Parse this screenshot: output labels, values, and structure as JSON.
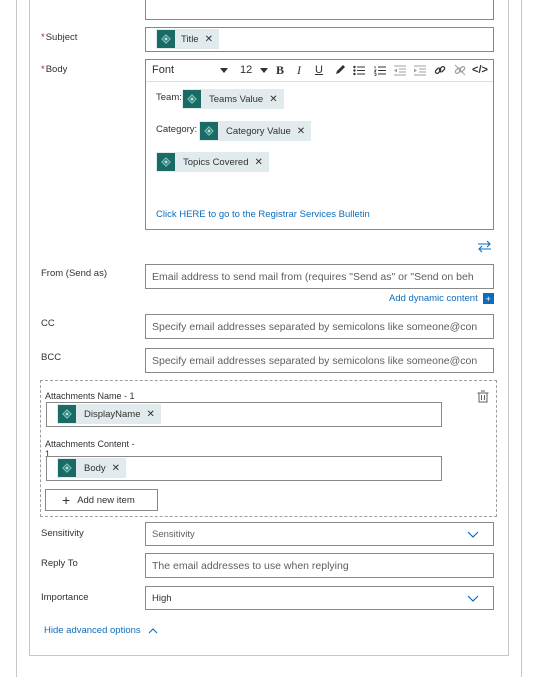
{
  "subject": {
    "label": "Subject",
    "required_mark": "*",
    "token": "Title"
  },
  "body": {
    "label": "Body",
    "required_mark": "*",
    "toolbar": {
      "font_label": "Font",
      "size_label": "12",
      "bold": "B",
      "italic": "I",
      "underline": "U",
      "code": "</>"
    },
    "team_prefix": "Team:",
    "team_token": "Teams Value",
    "category_prefix": "Category:",
    "category_token": "Category Value",
    "topics_token": "Topics Covered",
    "bulletin_link": "Click HERE to go to the Registrar Services Bulletin"
  },
  "from": {
    "label": "From (Send as)",
    "placeholder": "Email address to send mail from (requires \"Send as\" or \"Send on beh"
  },
  "add_dynamic": {
    "label": "Add dynamic content",
    "plus": "+"
  },
  "cc": {
    "label": "CC",
    "placeholder": "Specify email addresses separated by semicolons like someone@con"
  },
  "bcc": {
    "label": "BCC",
    "placeholder": "Specify email addresses separated by semicolons like someone@con"
  },
  "attachments": {
    "name_label": "Attachments Name - 1",
    "name_token": "DisplayName",
    "content_label": "Attachments Content -",
    "content_label_2": "1",
    "content_token": "Body",
    "add_item": "Add new item"
  },
  "sensitivity": {
    "label": "Sensitivity",
    "value": "Sensitivity"
  },
  "reply_to": {
    "label": "Reply To",
    "placeholder": "The email addresses to use when replying"
  },
  "importance": {
    "label": "Importance",
    "value": "High"
  },
  "hide_advanced": "Hide advanced options",
  "colors": {
    "token_bg": "#e1ebed",
    "token_icon": "#1a6b66",
    "link": "#0f6cbd",
    "required": "#a4262c"
  },
  "icons": [
    "expression-icon",
    "close-icon",
    "chevron-down-icon",
    "swap-icon",
    "delete-icon",
    "plus-icon",
    "chevron-up-icon"
  ]
}
